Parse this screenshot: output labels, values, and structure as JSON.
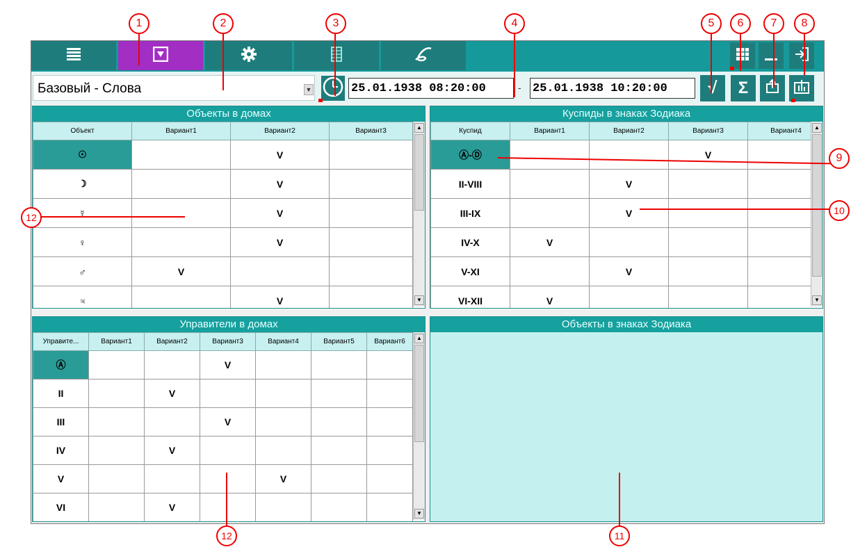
{
  "toolbar": {
    "tabs": [
      {
        "icon": "list-icon"
      },
      {
        "icon": "filter-icon"
      },
      {
        "icon": "gear-icon"
      },
      {
        "icon": "table-icon"
      },
      {
        "icon": "script-icon"
      }
    ],
    "right_buttons": [
      {
        "icon": "grid-icon"
      },
      {
        "icon": "minimize-icon"
      },
      {
        "icon": "exit-icon"
      }
    ]
  },
  "selector": {
    "value": "Базовый - Слова"
  },
  "dates": {
    "start": "25.01.1938 08:20:00",
    "separator": "-",
    "end": "25.01.1938 10:20:00"
  },
  "action_buttons": {
    "apply": "√",
    "sum": "Σ"
  },
  "panels": {
    "objects_in_houses": {
      "title": "Объекты в домах",
      "columns": [
        "Объект",
        "Вариант1",
        "Вариант2",
        "Вариант3"
      ],
      "rows": [
        [
          "☉",
          "",
          "V",
          ""
        ],
        [
          "☽",
          "",
          "V",
          ""
        ],
        [
          "☿",
          "",
          "V",
          ""
        ],
        [
          "♀",
          "",
          "V",
          ""
        ],
        [
          "♂",
          "V",
          "",
          ""
        ],
        [
          "♃",
          "",
          "V",
          ""
        ]
      ]
    },
    "cusps_in_zodiac": {
      "title": "Куспиды в знаках Зодиака",
      "columns": [
        "Куспид",
        "Вариант1",
        "Вариант2",
        "Вариант3",
        "Вариант4"
      ],
      "rows": [
        [
          "Ⓐ-Ⓓ",
          "",
          "",
          "V",
          ""
        ],
        [
          "II-VIII",
          "",
          "V",
          "",
          ""
        ],
        [
          "III-IX",
          "",
          "V",
          "",
          ""
        ],
        [
          "IV-X",
          "V",
          "",
          "",
          ""
        ],
        [
          "V-XI",
          "",
          "V",
          "",
          ""
        ],
        [
          "VI-XII",
          "V",
          "",
          "",
          ""
        ]
      ]
    },
    "rulers_in_houses": {
      "title": "Управители в домах",
      "columns": [
        "Управите...",
        "Вариант1",
        "Вариант2",
        "Вариант3",
        "Вариант4",
        "Вариант5",
        "Вариант6"
      ],
      "rows": [
        [
          "Ⓐ",
          "",
          "",
          "V",
          "",
          "",
          ""
        ],
        [
          "II",
          "",
          "V",
          "",
          "",
          "",
          ""
        ],
        [
          "III",
          "",
          "",
          "V",
          "",
          "",
          ""
        ],
        [
          "IV",
          "",
          "V",
          "",
          "",
          "",
          ""
        ],
        [
          "V",
          "",
          "",
          "",
          "V",
          "",
          ""
        ],
        [
          "VI",
          "",
          "V",
          "",
          "",
          "",
          ""
        ]
      ]
    },
    "objects_in_zodiac": {
      "title": "Объекты в знаках Зодиака"
    }
  },
  "callouts": [
    "1",
    "2",
    "3",
    "4",
    "5",
    "6",
    "7",
    "8",
    "9",
    "10",
    "11",
    "12",
    "12"
  ],
  "colors": {
    "teal": "#16999a",
    "dark_teal": "#1e7d7c",
    "active_tab": "#a22ec4",
    "header_cell": "#c8f0f0",
    "empty_panel": "#c4f0f0",
    "callout_red": "#e00000"
  }
}
